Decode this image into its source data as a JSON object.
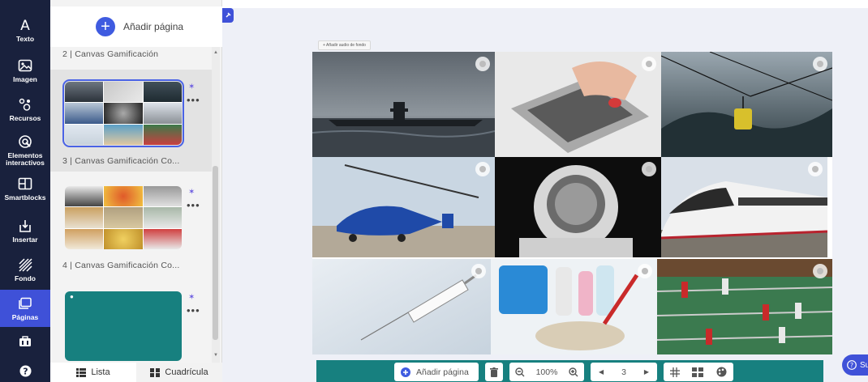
{
  "toolbar": {
    "items": [
      {
        "label": "Texto",
        "icon": "text-icon"
      },
      {
        "label": "Imagen",
        "icon": "image-icon"
      },
      {
        "label": "Recursos",
        "icon": "resources-icon"
      },
      {
        "label": "Elementos\ninteractivos",
        "icon": "interactive-elements-icon"
      },
      {
        "label": "Smartblocks",
        "icon": "smartblocks-icon"
      },
      {
        "label": "Insertar",
        "icon": "insert-icon"
      },
      {
        "label": "Fondo",
        "icon": "background-icon"
      },
      {
        "label": "Páginas",
        "icon": "pages-icon"
      },
      {
        "label": "",
        "icon": "toolbox-icon"
      },
      {
        "label": "",
        "icon": "help-icon"
      }
    ],
    "active_label": "Páginas",
    "accent_color": "#3f51d8",
    "background_color": "#19213d"
  },
  "pages_panel": {
    "add_page_label": "Añadir página",
    "pages": [
      {
        "label": "2 | Canvas Gamificación"
      },
      {
        "label": "3 | Canvas Gamificación Co...",
        "selected": true
      },
      {
        "label": "4 | Canvas Gamificación Co..."
      }
    ],
    "more_label": "•••",
    "view_tabs": {
      "list": "Lista",
      "grid": "Cuadrícula"
    }
  },
  "canvas": {
    "audio_button_label": "+   Añadir audio de fondo",
    "images": [
      {
        "name": "submarine",
        "desc": "submarine at sea"
      },
      {
        "name": "calculator",
        "desc": "calculator with hand"
      },
      {
        "name": "cable-car",
        "desc": "cable car in fog"
      },
      {
        "name": "gyroplane",
        "desc": "blue gyrocopter"
      },
      {
        "name": "astronaut",
        "desc": "astronaut helmet"
      },
      {
        "name": "train",
        "desc": "high-speed train"
      },
      {
        "name": "syringe",
        "desc": "syringe"
      },
      {
        "name": "mop",
        "desc": "mop and bucket"
      },
      {
        "name": "foosball",
        "desc": "foosball table"
      }
    ]
  },
  "bottom_bar": {
    "add_page_label": "Añadir página",
    "zoom": "100%",
    "page_number": "3",
    "color": "#17807f"
  },
  "help_button_label": "Su"
}
